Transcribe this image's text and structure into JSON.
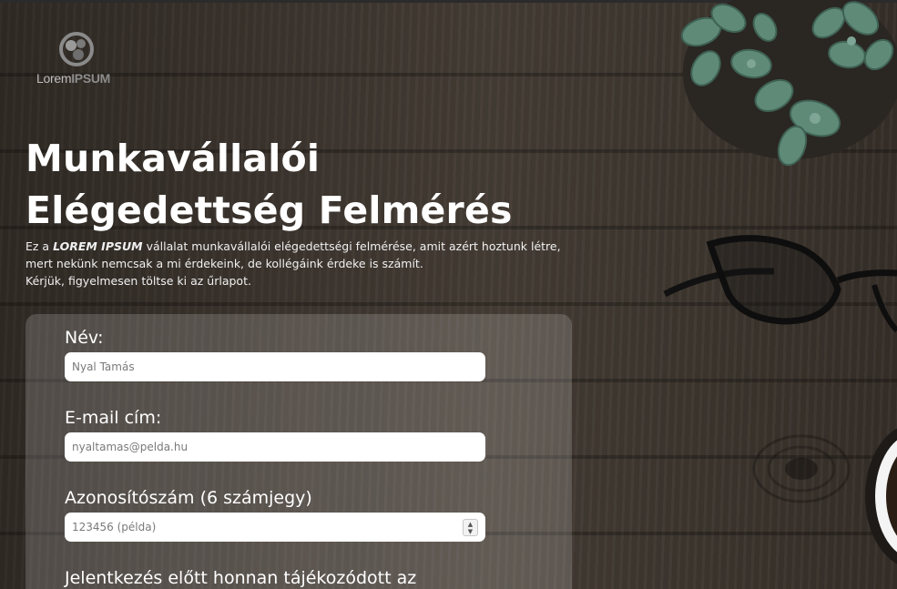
{
  "logo": {
    "text_light": "Lorem",
    "text_bold": "IPSUM"
  },
  "header": {
    "title": "Munkavállalói Elégedettség Felmérés",
    "intro_prefix": "Ez a ",
    "intro_company": "LOREM IPSUM",
    "intro_suffix": " vállalat munkavállalói elégedettségi felmérése, amit azért hoztunk létre, mert nekünk nemcsak a mi érdekeink, de kollégáink érdeke is számít.",
    "intro_line2": "Kérjük, figyelmesen töltse ki az űrlapot."
  },
  "form": {
    "name": {
      "label": "Név:",
      "placeholder": "Nyal Tamás"
    },
    "email": {
      "label": "E-mail cím:",
      "placeholder": "nyaltamas@pelda.hu"
    },
    "id_number": {
      "label": "Azonosítószám (6 számjegy)",
      "placeholder": "123456 (példa)"
    },
    "source": {
      "label": "Jelentkezés előtt honnan tájékozódott az"
    }
  },
  "colors": {
    "panel": "rgba(255,255,255,0.17)",
    "text": "#ffffff",
    "input_bg": "#ffffff"
  }
}
